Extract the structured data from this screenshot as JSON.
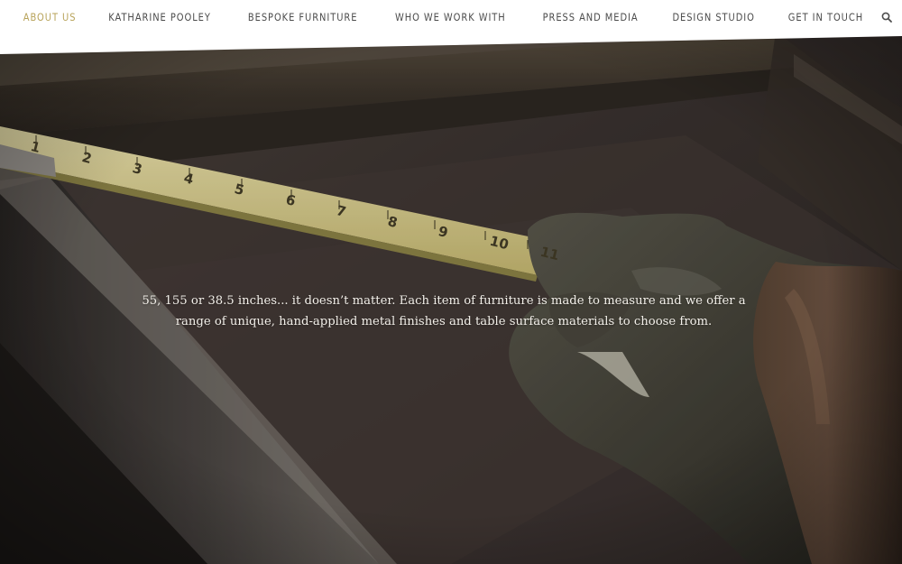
{
  "nav": {
    "items": [
      {
        "label": "ABOUT US",
        "active": true
      },
      {
        "label": "KATHARINE POOLEY",
        "active": false
      },
      {
        "label": "BESPOKE FURNITURE",
        "active": false
      },
      {
        "label": "WHO WE WORK WITH",
        "active": false
      },
      {
        "label": "PRESS AND MEDIA",
        "active": false
      },
      {
        "label": "DESIGN STUDIO",
        "active": false
      },
      {
        "label": "GET IN TOUCH",
        "active": false
      }
    ],
    "search_icon": "search-icon",
    "colors": {
      "active": "#b8a35a",
      "default": "#4c4c4c",
      "background": "#ffffff"
    }
  },
  "hero": {
    "caption": "55, 155 or 38.5 inches... it doesn’t matter. Each item of furniture is made to measure and we offer a range of unique, hand-applied metal finishes and table surface materials to choose from.",
    "tape_numbers": [
      "1",
      "2",
      "3",
      "4",
      "5",
      "6",
      "7",
      "8",
      "9",
      "10",
      "11"
    ],
    "image": "tape-measure-in-gloved-hand-on-metal-frame"
  }
}
